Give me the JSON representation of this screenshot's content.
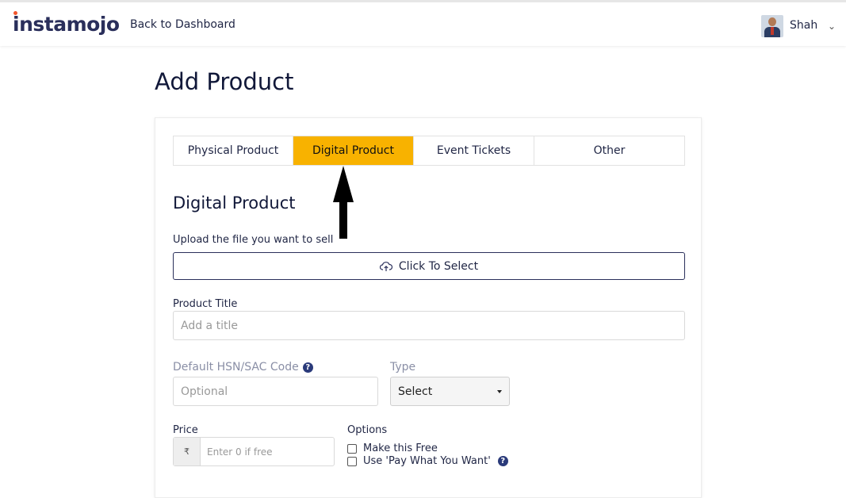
{
  "header": {
    "logo_text": "instamojo",
    "back_link": "Back to Dashboard",
    "user_name": "Shah"
  },
  "page": {
    "title": "Add Product"
  },
  "tabs": [
    {
      "label": "Physical Product",
      "active": false
    },
    {
      "label": "Digital Product",
      "active": true
    },
    {
      "label": "Event Tickets",
      "active": false
    },
    {
      "label": "Other",
      "active": false
    }
  ],
  "form": {
    "section_title": "Digital Product",
    "upload_label": "Upload the file you want to sell",
    "upload_button": "Click To Select",
    "product_title_label": "Product Title",
    "product_title_placeholder": "Add a title",
    "hsn_label": "Default HSN/SAC Code",
    "hsn_placeholder": "Optional",
    "type_label": "Type",
    "type_value": "Select",
    "price_label": "Price",
    "price_currency": "₹",
    "price_placeholder": "Enter 0 if free",
    "options_label": "Options",
    "option_free": "Make this Free",
    "option_pwyw": "Use 'Pay What You Want'"
  },
  "colors": {
    "active_tab": "#f8b200",
    "brand_navy": "#2a2f5b",
    "logo_dot": "#f2552c"
  }
}
